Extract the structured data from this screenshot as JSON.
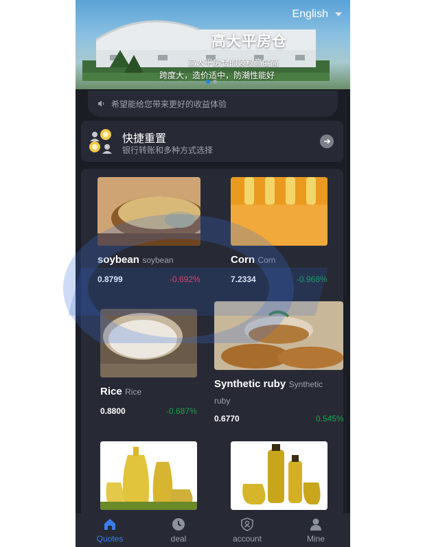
{
  "banner": {
    "language": "English",
    "title": "高大平房仓",
    "subtitle_line1": "高大平房仓的装粮高度高",
    "subtitle_line2": "跨度大，造价适中，防潮性能好"
  },
  "notice": {
    "text": "希望能给您带来更好的收益体验"
  },
  "quick": {
    "title": "快捷重置",
    "subtitle": "银行转账和多种方式选择"
  },
  "products": [
    {
      "name": "soybean",
      "sub": "soybean",
      "price": "0.8799",
      "change": "-0.692%"
    },
    {
      "name": "Corn",
      "sub": "Corn",
      "price": "7.2334",
      "change": "-0.968%"
    },
    {
      "name": "Rice",
      "sub": "Rice",
      "price": "0.8800",
      "change": "-0.687%"
    },
    {
      "name": "Synthetic ruby",
      "sub": "Synthetic",
      "sub2": "ruby",
      "price": "0.6770",
      "change": "0.545%"
    }
  ],
  "colors": {
    "negative": "#ff3c54",
    "positive": "#1aa34a",
    "accent": "#3d7be8"
  },
  "tabs": [
    {
      "label": "Quotes",
      "icon": "home-icon",
      "active": true
    },
    {
      "label": "deal",
      "icon": "clock-icon",
      "active": false
    },
    {
      "label": "account",
      "icon": "shield-user-icon",
      "active": false
    },
    {
      "label": "Mine",
      "icon": "person-icon",
      "active": false
    }
  ]
}
